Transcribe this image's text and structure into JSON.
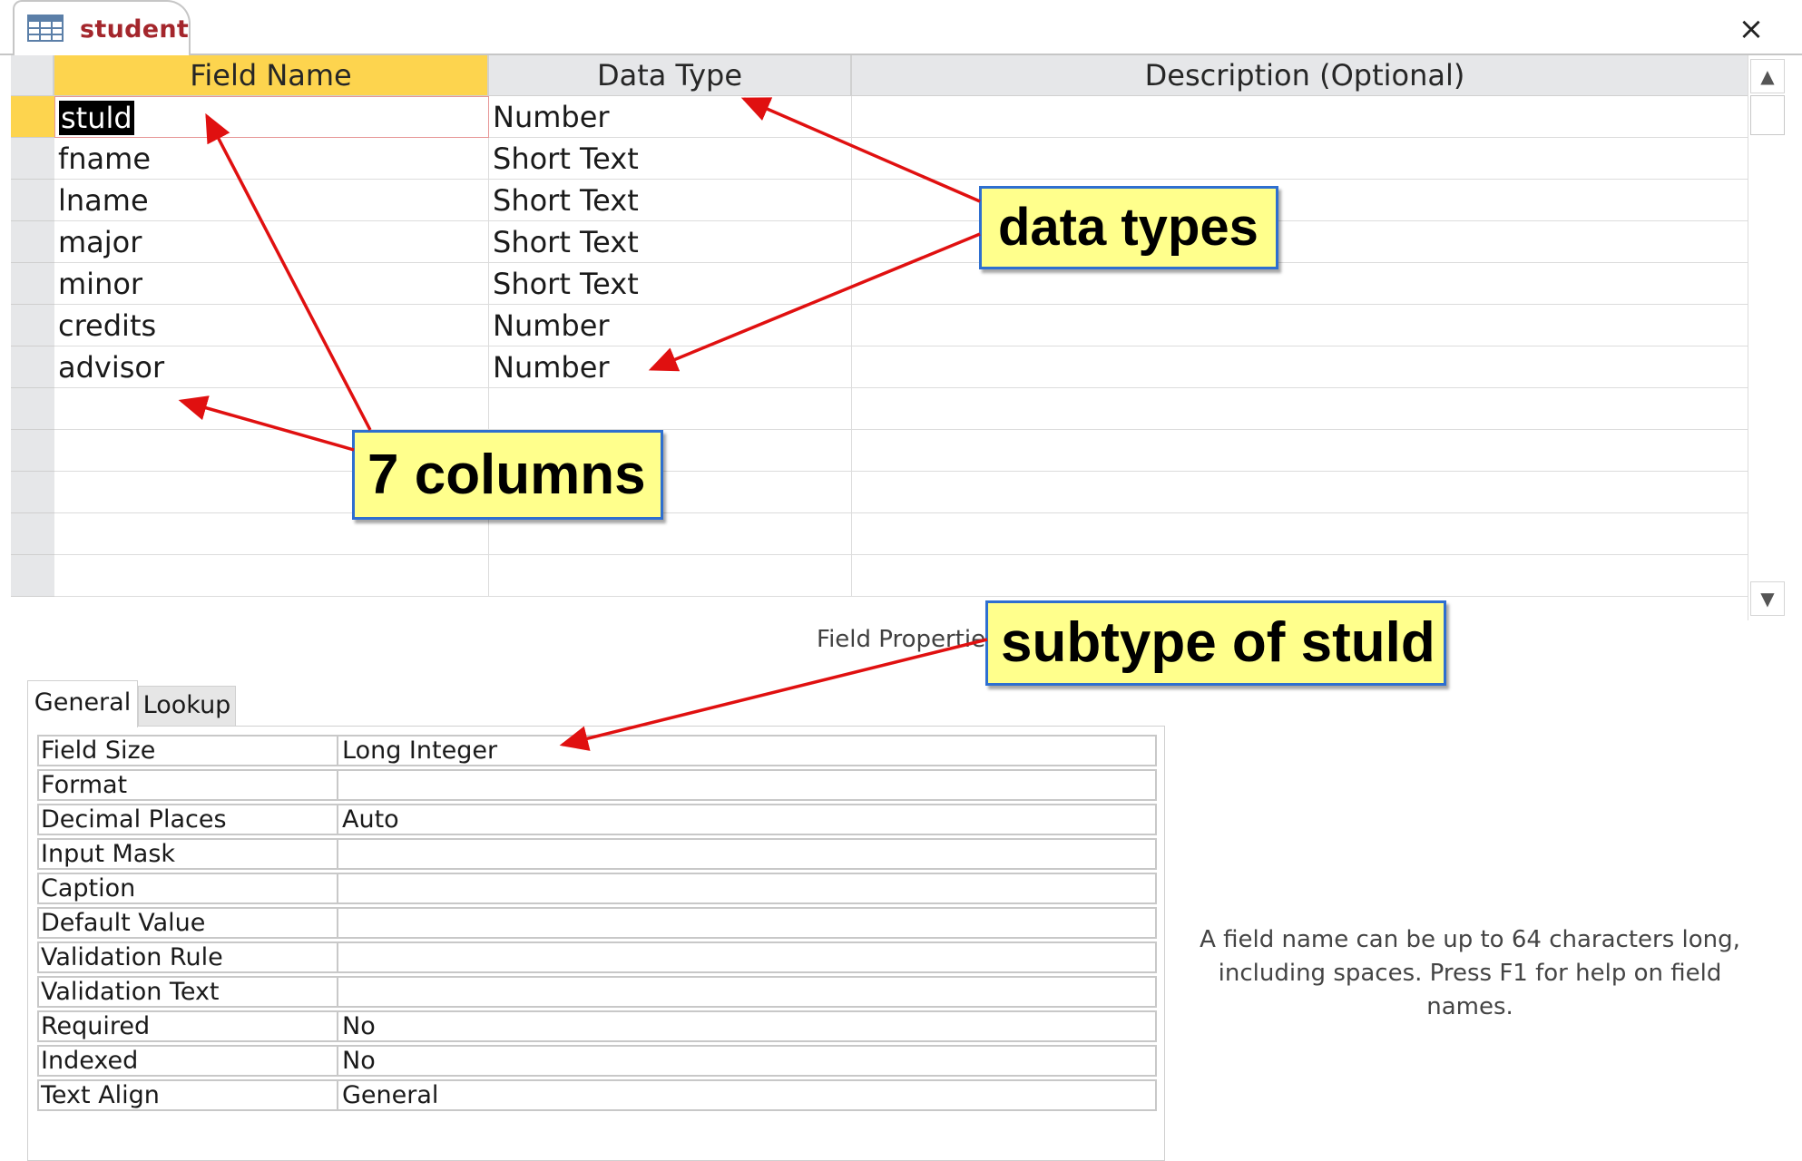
{
  "tab": {
    "title": "student",
    "icon": "table-icon"
  },
  "window": {
    "close_glyph": "×"
  },
  "grid": {
    "headers": [
      "Field Name",
      "Data Type",
      "Description (Optional)"
    ],
    "rows": [
      {
        "field_name": "stuld",
        "data_type": "Number",
        "description": ""
      },
      {
        "field_name": "fname",
        "data_type": "Short Text",
        "description": ""
      },
      {
        "field_name": "lname",
        "data_type": "Short Text",
        "description": ""
      },
      {
        "field_name": "major",
        "data_type": "Short Text",
        "description": ""
      },
      {
        "field_name": "minor",
        "data_type": "Short Text",
        "description": ""
      },
      {
        "field_name": "credits",
        "data_type": "Number",
        "description": ""
      },
      {
        "field_name": "advisor",
        "data_type": "Number",
        "description": ""
      }
    ],
    "selected_row": 0
  },
  "field_properties": {
    "title": "Field Properties",
    "tabs": {
      "general": "General",
      "lookup": "Lookup"
    },
    "properties": [
      {
        "name": "Field Size",
        "value": "Long Integer"
      },
      {
        "name": "Format",
        "value": ""
      },
      {
        "name": "Decimal Places",
        "value": "Auto"
      },
      {
        "name": "Input Mask",
        "value": ""
      },
      {
        "name": "Caption",
        "value": ""
      },
      {
        "name": "Default Value",
        "value": ""
      },
      {
        "name": "Validation Rule",
        "value": ""
      },
      {
        "name": "Validation Text",
        "value": ""
      },
      {
        "name": "Required",
        "value": "No"
      },
      {
        "name": "Indexed",
        "value": "No"
      },
      {
        "name": "Text Align",
        "value": "General"
      }
    ],
    "help_text": "A field name can be up to 64 characters long, including spaces. Press F1 for help on field names."
  },
  "callouts": {
    "data_types": "data types",
    "columns": "7 columns",
    "subtype": "subtype of stuld"
  },
  "colors": {
    "active_header": "#fdd44e",
    "tab_title": "#a4262c",
    "callout_fill": "#ffff8c",
    "callout_border": "#2e6fd0",
    "arrow": "#e01010"
  }
}
